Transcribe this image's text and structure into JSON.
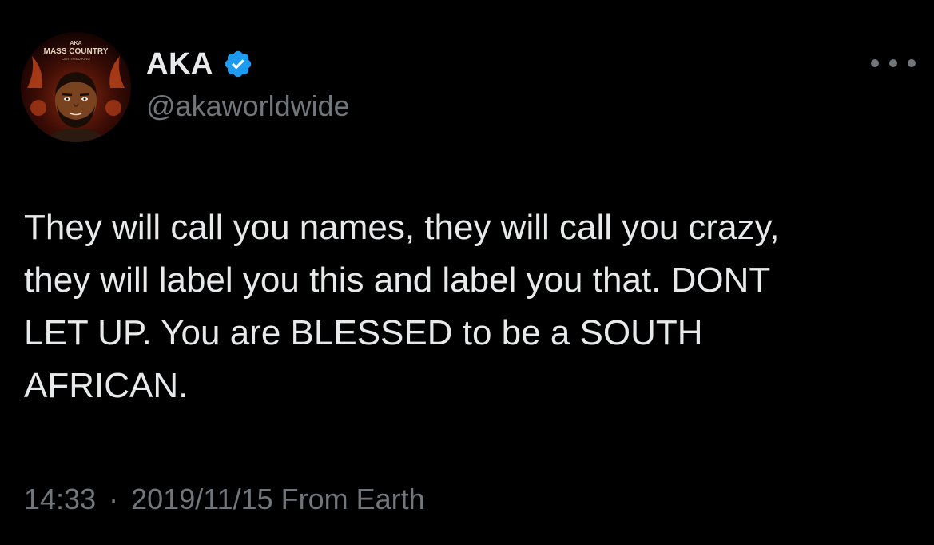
{
  "tweet": {
    "author": {
      "display_name": "AKA",
      "handle": "@akaworldwide",
      "verified": true,
      "avatar_text_top": "AKA",
      "avatar_text_main": "MASS COUNTRY",
      "avatar_text_sub": "CERTIFIED KING"
    },
    "more_icon": "more-horizontal-icon",
    "text": "They will call you names, they will call you crazy,\nthey will label you this and label you that. DONT\nLET UP. You are BLESSED to be a SOUTH\nAFRICAN.",
    "time": "14:33",
    "separator": "·",
    "date": "2019/11/15",
    "source": "From Earth"
  },
  "colors": {
    "background": "#000000",
    "primary_text": "#e7e9ea",
    "secondary_text": "#71767b",
    "verified_blue": "#1d9bf0"
  }
}
